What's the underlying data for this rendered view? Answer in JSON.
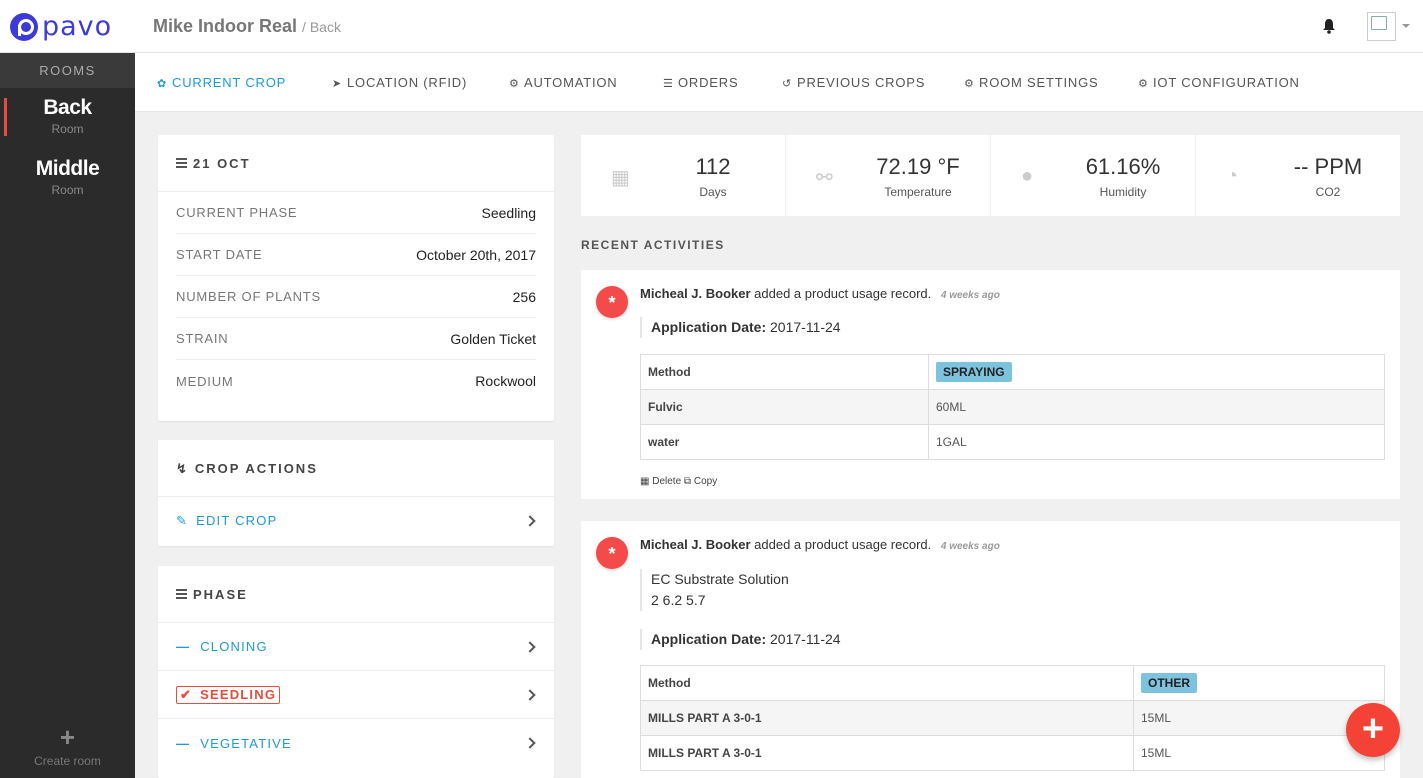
{
  "app": {
    "logo_text": "pavo"
  },
  "header": {
    "title": "Mike Indoor Real",
    "subtitle": "/ Back"
  },
  "sidebar": {
    "heading": "ROOMS",
    "rooms": [
      {
        "name": "Back",
        "sub": "Room"
      },
      {
        "name": "Middle",
        "sub": "Room"
      }
    ],
    "create_label": "Create room"
  },
  "tabs": [
    {
      "label": "CURRENT CROP"
    },
    {
      "label": "LOCATION (RFID)"
    },
    {
      "label": "AUTOMATION"
    },
    {
      "label": "ORDERS"
    },
    {
      "label": "PREVIOUS CROPS"
    },
    {
      "label": "ROOM SETTINGS"
    },
    {
      "label": "IOT CONFIGURATION"
    }
  ],
  "crop": {
    "title": "21 OCT",
    "rows": [
      {
        "label": "CURRENT PHASE",
        "value": "Seedling"
      },
      {
        "label": "START DATE",
        "value": "October 20th, 2017"
      },
      {
        "label": "NUMBER OF PLANTS",
        "value": "256"
      },
      {
        "label": "STRAIN",
        "value": "Golden Ticket"
      },
      {
        "label": "MEDIUM",
        "value": "Rockwool"
      }
    ]
  },
  "crop_actions": {
    "title": "CROP ACTIONS",
    "items": [
      {
        "label": "EDIT CROP"
      }
    ]
  },
  "phase": {
    "title": "PHASE",
    "items": [
      {
        "label": "CLONING"
      },
      {
        "label": "SEEDLING"
      },
      {
        "label": "VEGETATIVE"
      }
    ]
  },
  "stats": [
    {
      "value": "112",
      "label": "Days"
    },
    {
      "value": "72.19 °F",
      "label": "Temperature"
    },
    {
      "value": "61.16%",
      "label": "Humidity"
    },
    {
      "value": "-- PPM",
      "label": "CO2"
    }
  ],
  "recent": {
    "title": "RECENT ACTIVITIES",
    "items": [
      {
        "user": "Micheal J. Booker",
        "action": "added a product usage record.",
        "time": "4 weeks ago",
        "app_date_label": "Application Date:",
        "app_date": "2017-11-24",
        "table": [
          {
            "k": "Method",
            "v": "SPRAYING"
          },
          {
            "k": "Fulvic",
            "v": "60ML"
          },
          {
            "k": "water",
            "v": "1GAL"
          }
        ],
        "delete_label": "Delete",
        "copy_label": "Copy"
      },
      {
        "user": "Micheal J. Booker",
        "action": "added a product usage record.",
        "time": "4 weeks ago",
        "note_line1": "EC Substrate Solution",
        "note_line2": "2 6.2 5.7",
        "app_date_label": "Application Date:",
        "app_date": "2017-11-24",
        "table": [
          {
            "k": "Method",
            "v": "OTHER"
          },
          {
            "k": "MILLS PART A 3-0-1",
            "v": "15ML"
          },
          {
            "k": "MILLS PART A 3-0-1",
            "v": "15ML"
          }
        ]
      }
    ]
  },
  "fab_label": "+"
}
